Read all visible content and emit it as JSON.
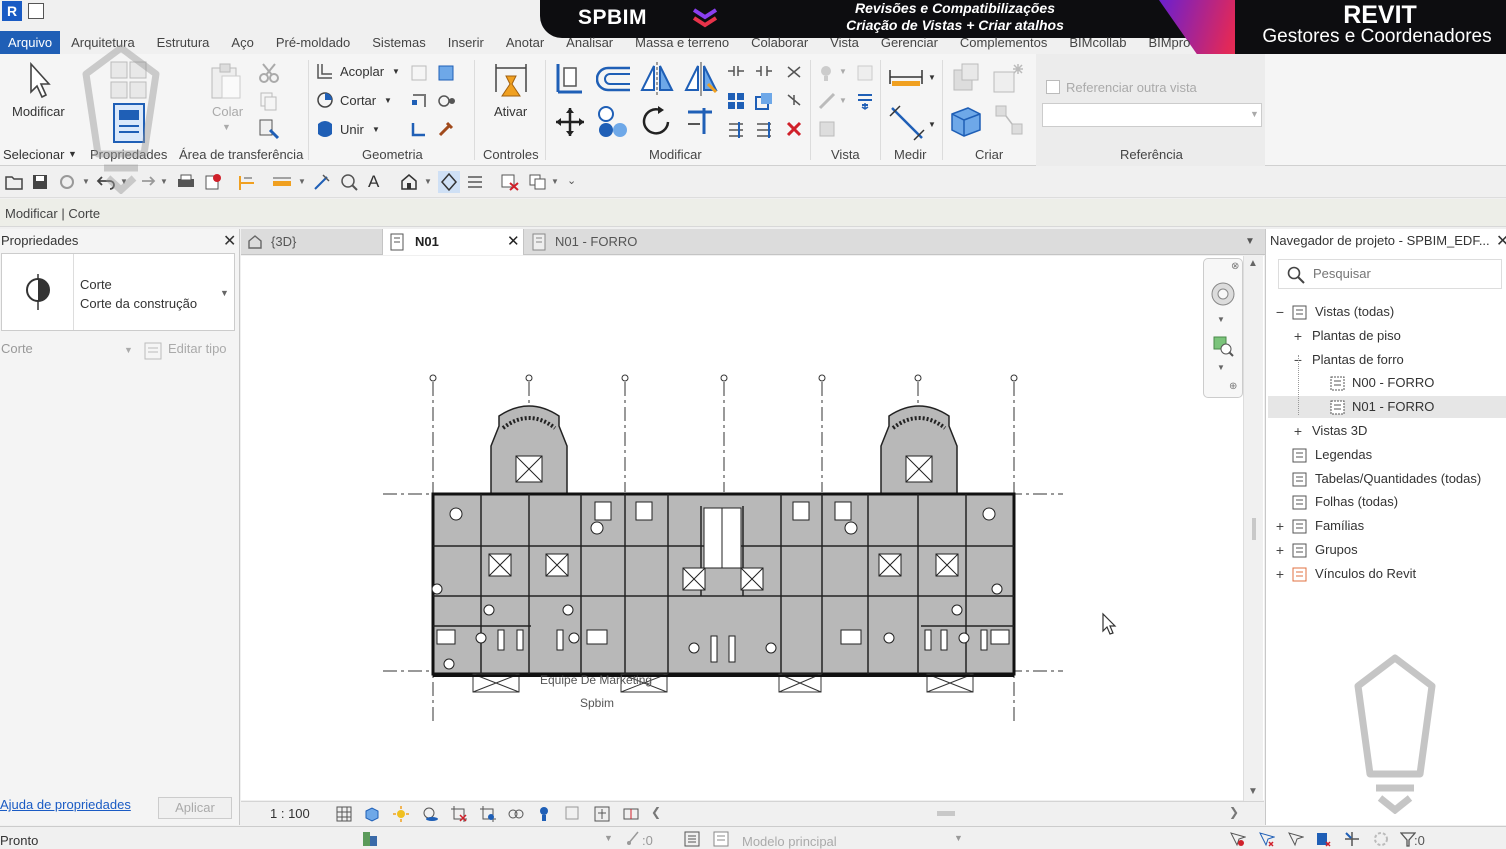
{
  "banner": {
    "brand": "SPBIM",
    "subtitle_line1": "Revisões e Compatibilizações",
    "subtitle_line2": "Criação de Vistas + Criar atalhos",
    "product": "REVIT",
    "audience": "Gestores e Coordenadores"
  },
  "app": {
    "logo_letter": "R"
  },
  "ribbon_tabs": [
    "Arquivo",
    "Arquitetura",
    "Estrutura",
    "Aço",
    "Pré-moldado",
    "Sistemas",
    "Inserir",
    "Anotar",
    "Analisar",
    "Massa e terreno",
    "Colaborar",
    "Vista",
    "Gerenciar",
    "Complementos",
    "BIMcollab",
    "BIMpro"
  ],
  "ribbon": {
    "modificar_label": "Modificar",
    "acoplar": "Acoplar",
    "cortar": "Cortar",
    "unir": "Unir",
    "colar": "Colar",
    "ativar": "Ativar",
    "referenciar_outra_vista": "Referenciar outra vista",
    "panels": {
      "selecionar": "Selecionar",
      "propriedades": "Propriedades",
      "area_transferencia": "Área de transferência",
      "geometria": "Geometria",
      "controles": "Controles",
      "modificar": "Modificar",
      "vista": "Vista",
      "medir": "Medir",
      "criar": "Criar",
      "referencia": "Referência"
    }
  },
  "options_bar": {
    "context": "Modificar | Corte"
  },
  "properties": {
    "title": "Propriedades",
    "type_name": "Corte",
    "type_sub": "Corte da construção",
    "filter": "Corte",
    "edit_type": "Editar tipo",
    "help_link": "Ajuda de propriedades",
    "apply": "Aplicar"
  },
  "view_tabs": [
    {
      "label": "{3D}",
      "active": false
    },
    {
      "label": "N01",
      "active": true
    },
    {
      "label": "N01 - FORRO",
      "active": false
    }
  ],
  "canvas": {
    "watermark_line1": "Equipe De Marketing",
    "watermark_line2": "Spbim"
  },
  "viewbar": {
    "scale": "1 : 100"
  },
  "browser": {
    "title": "Navegador de projeto - SPBIM_EDF...",
    "search_placeholder": "Pesquisar",
    "tree": [
      {
        "label": "Vistas (todas)",
        "toggle": "−",
        "depth": 0
      },
      {
        "label": "Plantas de piso",
        "toggle": "+",
        "depth": 1
      },
      {
        "label": "Plantas de forro",
        "toggle": "−",
        "depth": 1
      },
      {
        "label": "N00 - FORRO",
        "toggle": "",
        "depth": 2
      },
      {
        "label": "N01 - FORRO",
        "toggle": "",
        "depth": 2,
        "selected": true
      },
      {
        "label": "Vistas 3D",
        "toggle": "+",
        "depth": 1
      },
      {
        "label": "Legendas",
        "toggle": "",
        "depth": 0
      },
      {
        "label": "Tabelas/Quantidades (todas)",
        "toggle": "",
        "depth": 0
      },
      {
        "label": "Folhas (todas)",
        "toggle": "",
        "depth": 0
      },
      {
        "label": "Famílias",
        "toggle": "+",
        "depth": 0
      },
      {
        "label": "Grupos",
        "toggle": "+",
        "depth": 0
      },
      {
        "label": "Vínculos do Revit",
        "toggle": "+",
        "depth": 0
      }
    ]
  },
  "status": {
    "text": "Pronto",
    "coord_value": ":0",
    "model": "Modelo principal",
    "filter_count": ":0"
  },
  "colors": {
    "accent": "#1f5fb6",
    "banner": "#0d0d10",
    "plan_fill": "#b8b8b8"
  }
}
